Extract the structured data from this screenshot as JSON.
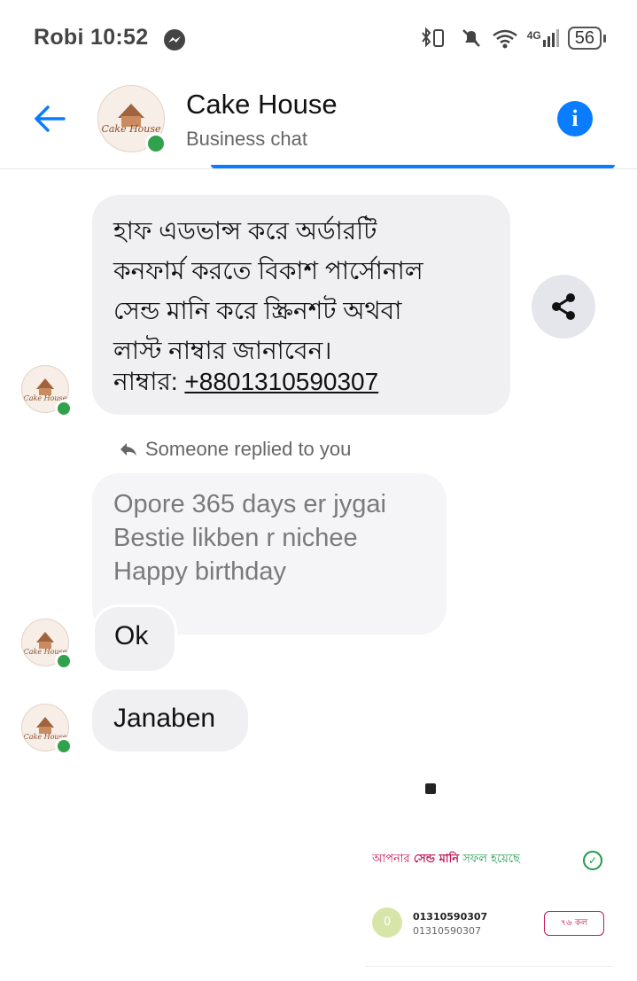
{
  "status_bar": {
    "carrier_time": "Robi 10:52",
    "network": "4G",
    "battery": "56"
  },
  "header": {
    "title": "Cake House",
    "subtitle": "Business chat",
    "info_icon": "i",
    "avatar_text": "Cake House"
  },
  "messages": {
    "m1_text": "হাফ এডভান্স করে অর্ডারটি\nকনফার্ম করতে বিকাশ পার্সোনাল\nসেন্ড মানি করে স্ক্রিনশট অথবা\nলাস্ট নাম্বার জানাবেন।",
    "m1_number_label": "নাম্বার: ",
    "m1_number": "+8801310590307",
    "reply_note": "Someone replied to you",
    "m2_text": "Opore 365 days er jygai\nBestie likben r nichee\nHappy birthday",
    "m3_text": "Ok",
    "m4_text": "Janaben"
  },
  "receipt": {
    "success_pre": "আপনার ",
    "success_mid": "সেন্ড মানি",
    "success_post": " সফল হয়েছে",
    "check": "✓",
    "avatar_letter": "0",
    "number_primary": "01310590307",
    "number_secondary": "01310590307",
    "call_label": "৭৬ কল"
  },
  "colors": {
    "accent": "#0a7cff",
    "online": "#31a24c",
    "bkash_pink": "#c2185b",
    "success_green": "#1e9a4b"
  }
}
